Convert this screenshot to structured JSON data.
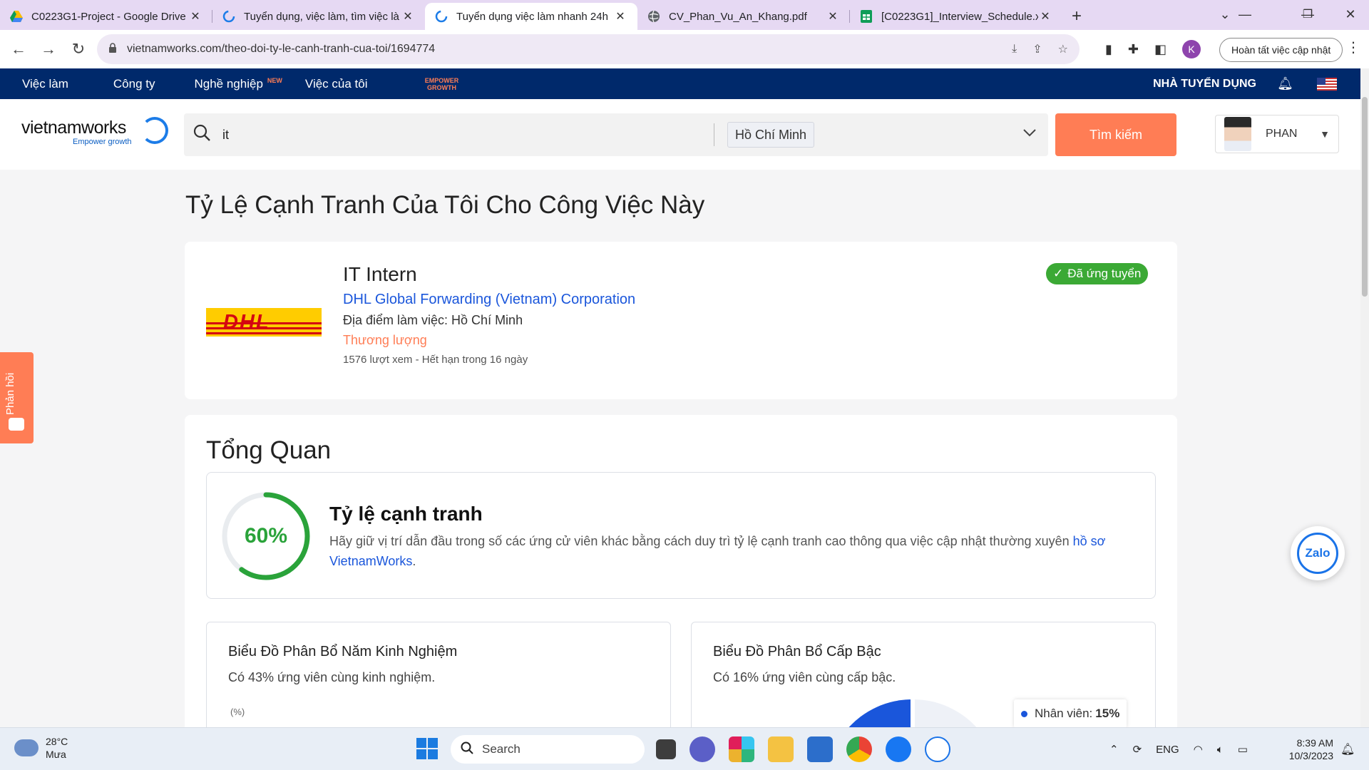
{
  "browser": {
    "tabs": [
      {
        "title": "C0223G1-Project - Google Drive",
        "icon": "google-drive-icon",
        "active": false
      },
      {
        "title": "Tuyển dụng, việc làm, tìm việc là",
        "icon": "vietnamworks-icon",
        "active": false
      },
      {
        "title": "Tuyển dụng việc làm nhanh 24h",
        "icon": "vietnamworks-icon",
        "active": true
      },
      {
        "title": "CV_Phan_Vu_An_Khang.pdf",
        "icon": "globe-icon",
        "active": false
      },
      {
        "title": "[C0223G1]_Interview_Schedule.x",
        "icon": "google-sheets-icon",
        "active": false
      }
    ],
    "url": "vietnamworks.com/theo-doi-ty-le-canh-tranh-cua-toi/1694774",
    "profile_initial": "K",
    "update_button": "Hoàn tất việc cập nhật"
  },
  "sitenav": {
    "items": [
      "Việc làm",
      "Công ty",
      "Nghề nghiệp",
      "Việc của tôi"
    ],
    "new_tag": "NEW",
    "empower_line1": "EMPOWER",
    "empower_line2": "GROWTH",
    "employer": "NHÀ TUYỂN DỤNG"
  },
  "header": {
    "logo_brand": "vietnamworks",
    "logo_tagline": "Empower growth",
    "search_query": "it",
    "location": "Hồ Chí Minh",
    "search_button": "Tìm kiếm",
    "user_name": "PHAN"
  },
  "page": {
    "title": "Tỷ Lệ Cạnh Tranh Của Tôi Cho Công Việc Này"
  },
  "job": {
    "logo_text": "DHL",
    "title": "IT Intern",
    "company": "DHL Global Forwarding (Vietnam) Corporation",
    "location": "Địa điểm làm việc: Hồ Chí Minh",
    "salary": "Thương lượng",
    "meta": "1576 lượt xem - Hết hạn trong 16 ngày",
    "status": "Đã ứng tuyển"
  },
  "overview": {
    "title": "Tổng Quan",
    "competition_percent": 60,
    "competition_label": "60%",
    "competition_title": "Tỷ lệ cạnh tranh",
    "competition_desc": "Hãy giữ vị trí dẫn đầu trong số các ứng cử viên khác bằng cách duy trì tỷ lệ cạnh tranh cao thông qua việc cập nhật thường xuyên ",
    "competition_link": "hồ sơ VietnamWorks",
    "competition_end": ".",
    "experience_chart": {
      "title": "Biểu Đồ Phân Bổ Năm Kinh Nghiệm",
      "subtitle": "Có 43% ứng viên cùng kinh nghiệm.",
      "unit": "(%)"
    },
    "level_chart": {
      "title": "Biểu Đồ Phân Bổ Cấp Bậc",
      "subtitle": "Có 16% ứng viên cùng cấp bậc.",
      "legend_label": "Nhân viên:",
      "legend_value": "15%"
    }
  },
  "widgets": {
    "feedback": "Phản hồi",
    "zalo": "Zalo"
  },
  "taskbar": {
    "temperature": "28°C",
    "weather": "Mưa",
    "search": "Search",
    "language": "ENG",
    "time": "8:39 AM",
    "date": "10/3/2023"
  },
  "colors": {
    "accent_orange": "#ff7d55",
    "nav_blue": "#00296b",
    "link_blue": "#1a56db",
    "success_green": "#3ba935"
  }
}
